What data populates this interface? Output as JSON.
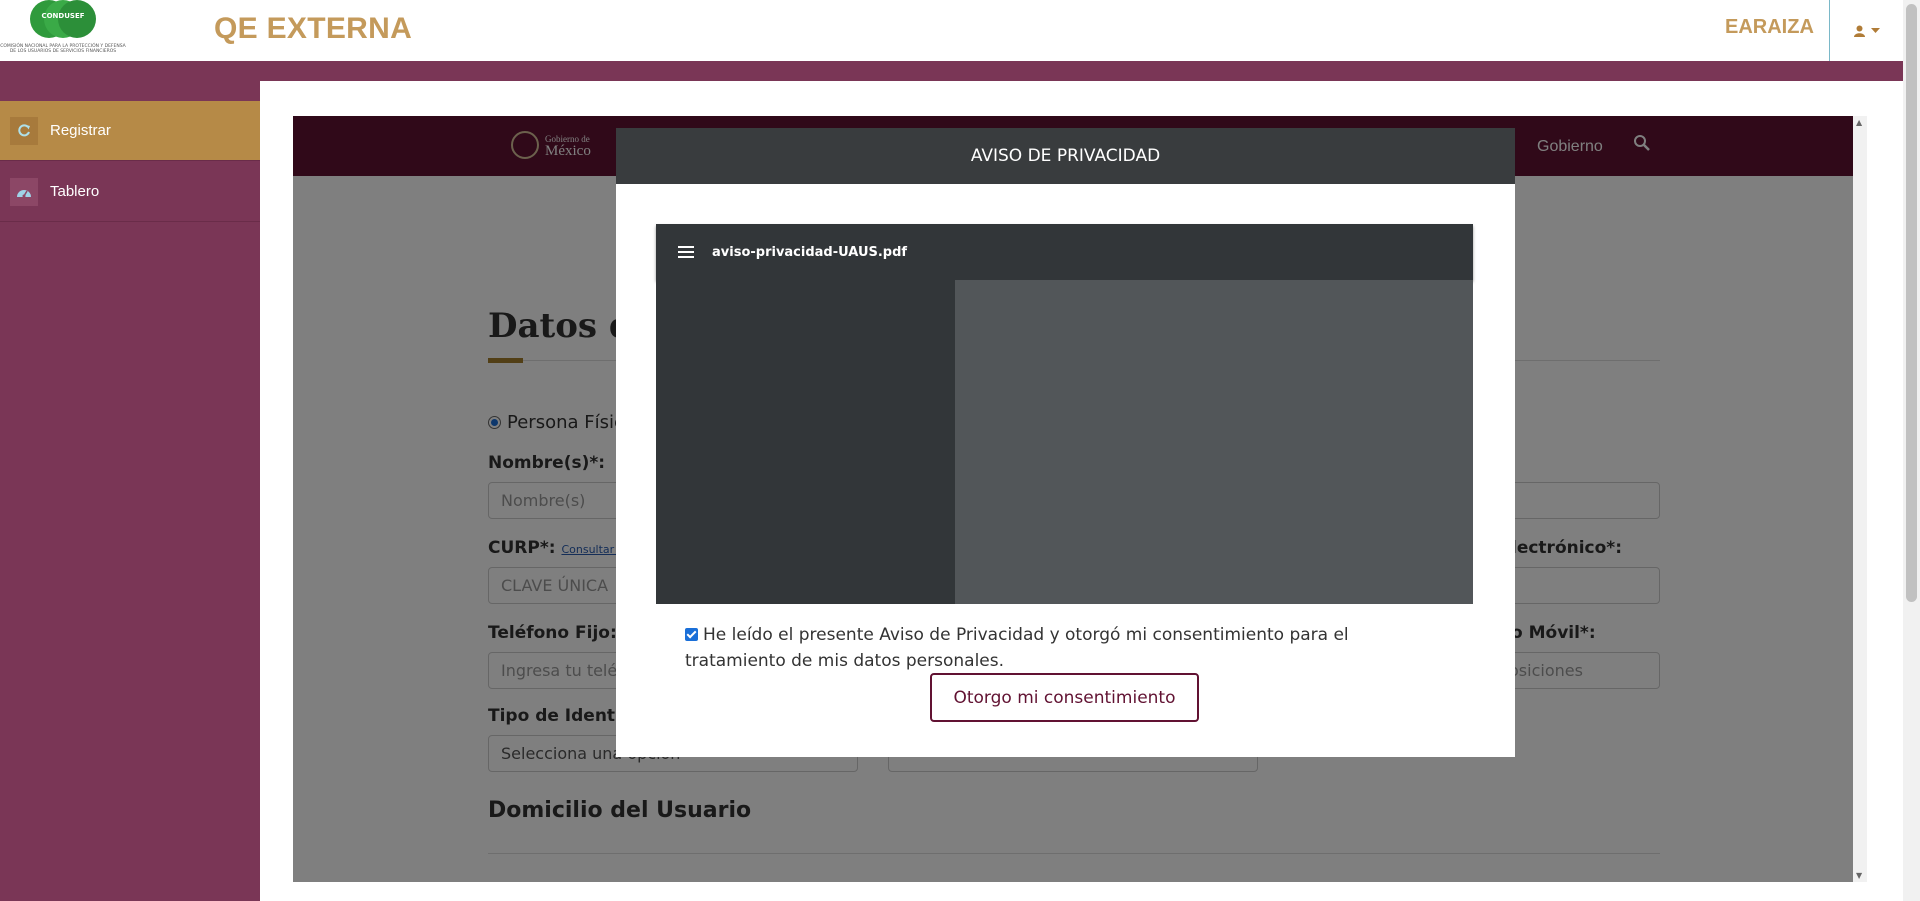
{
  "header": {
    "logo_word": "CONDUSEF",
    "logo_caption": "COMISIÓN NACIONAL PARA LA PROTECCIÓN Y DEFENSA DE LOS USUARIOS DE SERVICIOS FINANCIEROS",
    "app_title": "QE EXTERNA",
    "username": "EARAIZA",
    "user_icon": "user-icon",
    "caret_icon": "caret-down-icon"
  },
  "sidebar": {
    "items": [
      {
        "label": "Registrar",
        "icon": "refresh-icon",
        "active": true
      },
      {
        "label": "Tablero",
        "icon": "dashboard-icon",
        "active": false
      }
    ]
  },
  "gov": {
    "logo_small": "Gobierno de",
    "logo_big": "México",
    "nav_link": "Gobierno",
    "search_icon": "search-icon"
  },
  "form": {
    "title": "Datos d",
    "radio_label": "Persona Físic",
    "nombre_label": "Nombre(s)*:",
    "nombre_placeholder": "Nombre(s)",
    "curp_label": "CURP*:",
    "curp_link": "Consultar C",
    "curp_placeholder": "CLAVE ÚNICA",
    "email_label_fragment": "lectrónico*:",
    "tel_fijo_label": "Teléfono Fijo:",
    "tel_fijo_placeholder": "Ingresa tu telé",
    "tel_movil_label_fragment": "o Móvil*:",
    "tel_movil_placeholder_fragment": "osiciones",
    "tipo_id_label": "Tipo de Identit",
    "tipo_id_select": "Selecciona una opción",
    "domicilio_heading": "Domicilio del Usuario"
  },
  "modal": {
    "title": "AVISO DE PRIVACIDAD",
    "pdf_filename": "aviso-privacidad-UAUS.pdf",
    "pdf_menu_icon": "hamburger-menu-icon",
    "consent_text": "He leído el presente Aviso de Privacidad y otorgó mi consentimiento para el tratamiento de mis datos personales.",
    "consent_checked": true,
    "consent_button": "Otorgo mi consentimiento"
  }
}
